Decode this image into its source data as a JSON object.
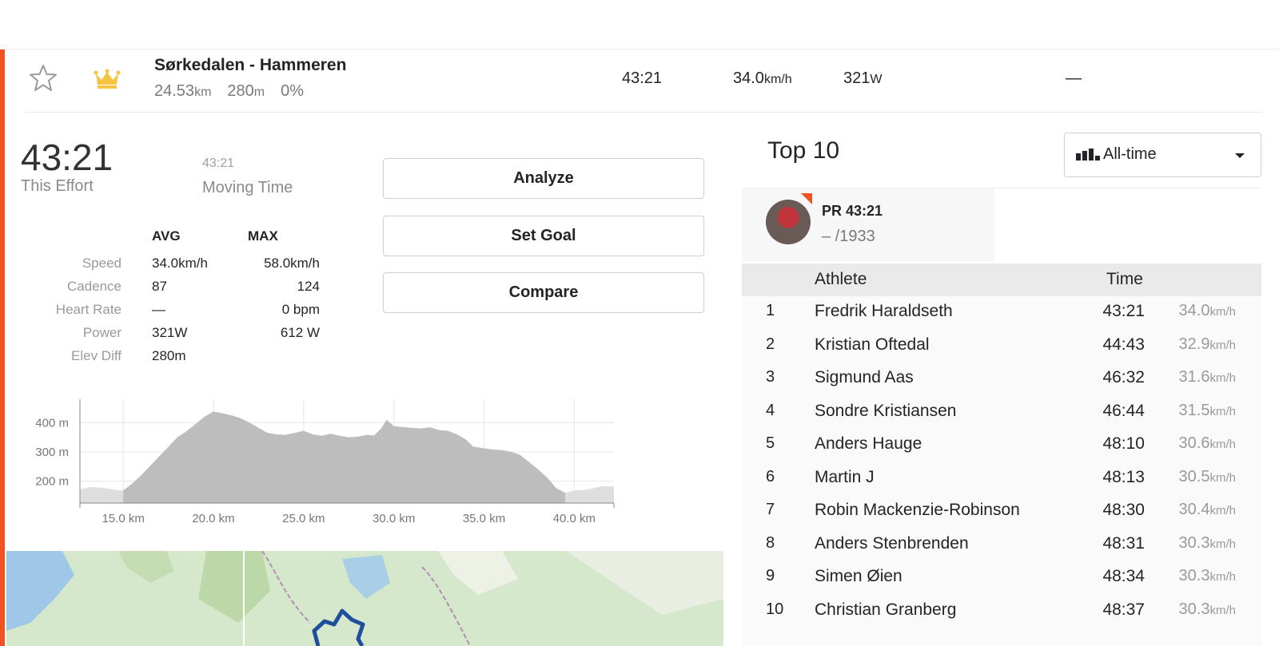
{
  "segment": {
    "name": "Sørkedalen - Hammeren",
    "distance_value": "24.53",
    "distance_unit": "km",
    "elevation_value": "280",
    "elevation_unit": "m",
    "grade": "0%",
    "time": "43:21",
    "speed_value": "34.0",
    "speed_unit": "km/h",
    "power_value": "321",
    "power_unit": "W",
    "hr": "—",
    "icons": {
      "star": "star-outline-icon",
      "crown": "crown-icon",
      "crown_color": "#f5c442"
    }
  },
  "effort": {
    "time": "43:21",
    "time_label": "This Effort",
    "moving_time": "43:21",
    "moving_label": "Moving Time"
  },
  "buttons": {
    "analyze": "Analyze",
    "set_goal": "Set Goal",
    "compare": "Compare"
  },
  "stats": {
    "avg_header": "AVG",
    "max_header": "MAX",
    "rows": [
      {
        "label": "Speed",
        "avg": "34.0km/h",
        "max": "58.0km/h"
      },
      {
        "label": "Cadence",
        "avg": "87",
        "max": "124"
      },
      {
        "label": "Heart Rate",
        "avg": "—",
        "max": "0 bpm"
      },
      {
        "label": "Power",
        "avg": "321W",
        "max": "612 W"
      },
      {
        "label": "Elev Diff",
        "avg": "280m",
        "max": ""
      }
    ]
  },
  "chart_data": {
    "type": "area",
    "x_ticks": [
      "15.0 km",
      "20.0 km",
      "25.0 km",
      "30.0 km",
      "35.0 km",
      "40.0 km"
    ],
    "y_ticks": [
      "400 m",
      "300 m",
      "200 m"
    ],
    "xlim": [
      12.6,
      42.2
    ],
    "ylim": [
      125,
      480
    ],
    "segment_range": [
      15.0,
      39.5
    ],
    "x": [
      12.6,
      13.2,
      14.0,
      14.6,
      15.0,
      15.5,
      16.0,
      17.0,
      18.0,
      18.5,
      19.0,
      19.5,
      20.0,
      20.5,
      21.0,
      21.5,
      22.0,
      22.5,
      23.0,
      23.5,
      24.0,
      24.5,
      25.0,
      25.5,
      26.0,
      26.5,
      27.0,
      27.5,
      28.0,
      28.5,
      28.9,
      29.3,
      29.6,
      30.0,
      30.5,
      31.0,
      31.5,
      32.0,
      32.5,
      33.0,
      33.5,
      34.0,
      34.4,
      35.0,
      35.5,
      36.0,
      36.5,
      37.0,
      37.5,
      38.0,
      38.5,
      39.0,
      39.5,
      40.0,
      40.5,
      41.0,
      41.5,
      42.2
    ],
    "y": [
      172,
      180,
      176,
      170,
      168,
      192,
      220,
      285,
      350,
      370,
      395,
      420,
      438,
      432,
      425,
      415,
      400,
      382,
      365,
      360,
      358,
      365,
      372,
      360,
      355,
      362,
      355,
      350,
      352,
      358,
      356,
      380,
      410,
      388,
      385,
      382,
      380,
      384,
      375,
      372,
      360,
      342,
      318,
      312,
      308,
      306,
      300,
      290,
      265,
      240,
      212,
      176,
      160,
      168,
      170,
      175,
      182,
      182
    ],
    "grid": true,
    "fill_color": "#bdbdbd",
    "outside_fill_color": "#dedede"
  },
  "top10": {
    "title": "Top 10",
    "filter": "All-time",
    "pr_label": "PR",
    "pr_time": "43:21",
    "pr_rank": "– /1933",
    "col_athlete": "Athlete",
    "col_time": "Time",
    "rows": [
      {
        "rank": "1",
        "name": "Fredrik Haraldseth",
        "time": "43:21",
        "speed": "34.0",
        "unit": "km/h"
      },
      {
        "rank": "2",
        "name": "Kristian Oftedal",
        "time": "44:43",
        "speed": "32.9",
        "unit": "km/h"
      },
      {
        "rank": "3",
        "name": "Sigmund Aas",
        "time": "46:32",
        "speed": "31.6",
        "unit": "km/h"
      },
      {
        "rank": "4",
        "name": "Sondre Kristiansen",
        "time": "46:44",
        "speed": "31.5",
        "unit": "km/h"
      },
      {
        "rank": "5",
        "name": "Anders Hauge",
        "time": "48:10",
        "speed": "30.6",
        "unit": "km/h"
      },
      {
        "rank": "6",
        "name": "Martin J",
        "time": "48:13",
        "speed": "30.5",
        "unit": "km/h"
      },
      {
        "rank": "7",
        "name": "Robin Mackenzie-Robinson",
        "time": "48:30",
        "speed": "30.4",
        "unit": "km/h"
      },
      {
        "rank": "8",
        "name": "Anders Stenbrenden",
        "time": "48:31",
        "speed": "30.3",
        "unit": "km/h"
      },
      {
        "rank": "9",
        "name": "Simen Øien",
        "time": "48:34",
        "speed": "30.3",
        "unit": "km/h"
      },
      {
        "rank": "10",
        "name": "Christian Granberg",
        "time": "48:37",
        "speed": "30.3",
        "unit": "km/h"
      }
    ]
  },
  "colors": {
    "accent": "#f05222",
    "route": "#1f4f9c"
  }
}
